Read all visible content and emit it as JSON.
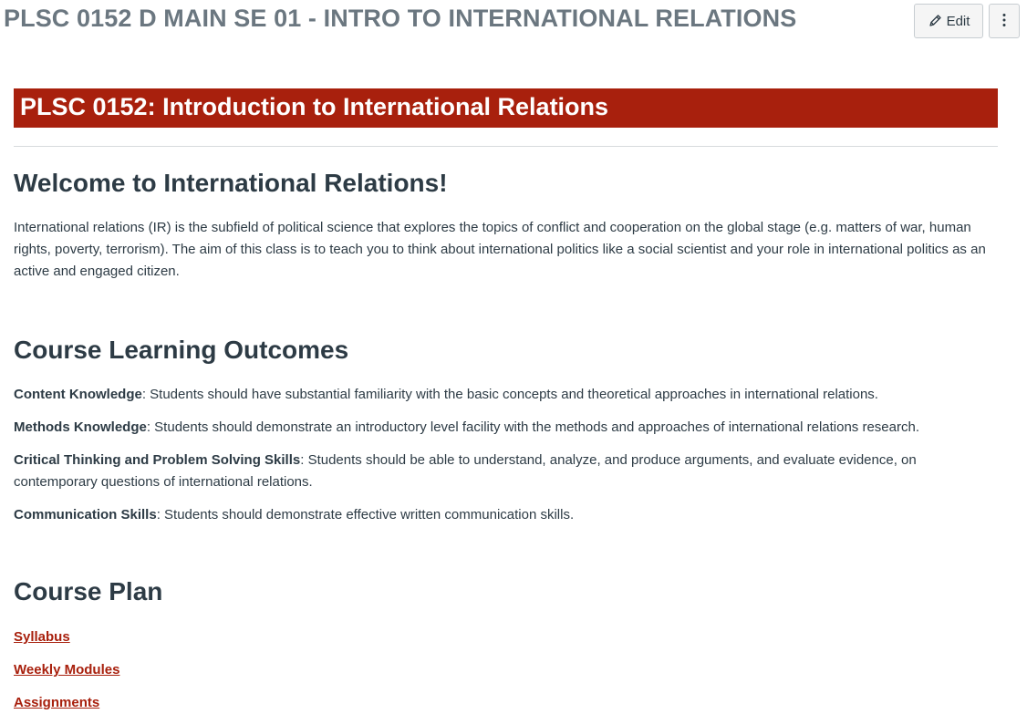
{
  "header": {
    "title": "PLSC 0152 D MAIN SE 01 - INTRO TO INTERNATIONAL RELATIONS",
    "edit_label": "Edit",
    "edit_icon": "pencil-icon",
    "more_icon": "vertical-ellipsis-icon"
  },
  "banner": {
    "title": "PLSC 0152: Introduction to International Relations",
    "background_color": "#a8200d"
  },
  "welcome": {
    "heading": "Welcome to International Relations!",
    "paragraph": "International relations (IR) is the subfield of political science that explores the topics of conflict and cooperation on the global stage (e.g. matters of war, human rights, poverty, terrorism). The aim of this class is to teach you to think about international politics like a social scientist and your role in international politics as an active and engaged citizen."
  },
  "outcomes": {
    "heading": "Course Learning Outcomes",
    "items": [
      {
        "term": "Content Knowledge",
        "text": ": Students should have substantial familiarity with the basic concepts and theoretical approaches in international relations."
      },
      {
        "term": "Methods Knowledge",
        "text": ": Students should demonstrate an introductory level facility with the methods and approaches of international relations research."
      },
      {
        "term": "Critical Thinking and Problem Solving Skills",
        "text": ": Students should be able to understand, analyze, and produce arguments, and evaluate evidence, on contemporary questions of international relations."
      },
      {
        "term": "Communication Skills",
        "text": ": Students should demonstrate effective written communication skills."
      }
    ]
  },
  "plan": {
    "heading": "Course Plan",
    "links": [
      {
        "label": "Syllabus"
      },
      {
        "label": "Weekly Modules"
      },
      {
        "label": "Assignments"
      }
    ],
    "link_color": "#a8200d"
  }
}
